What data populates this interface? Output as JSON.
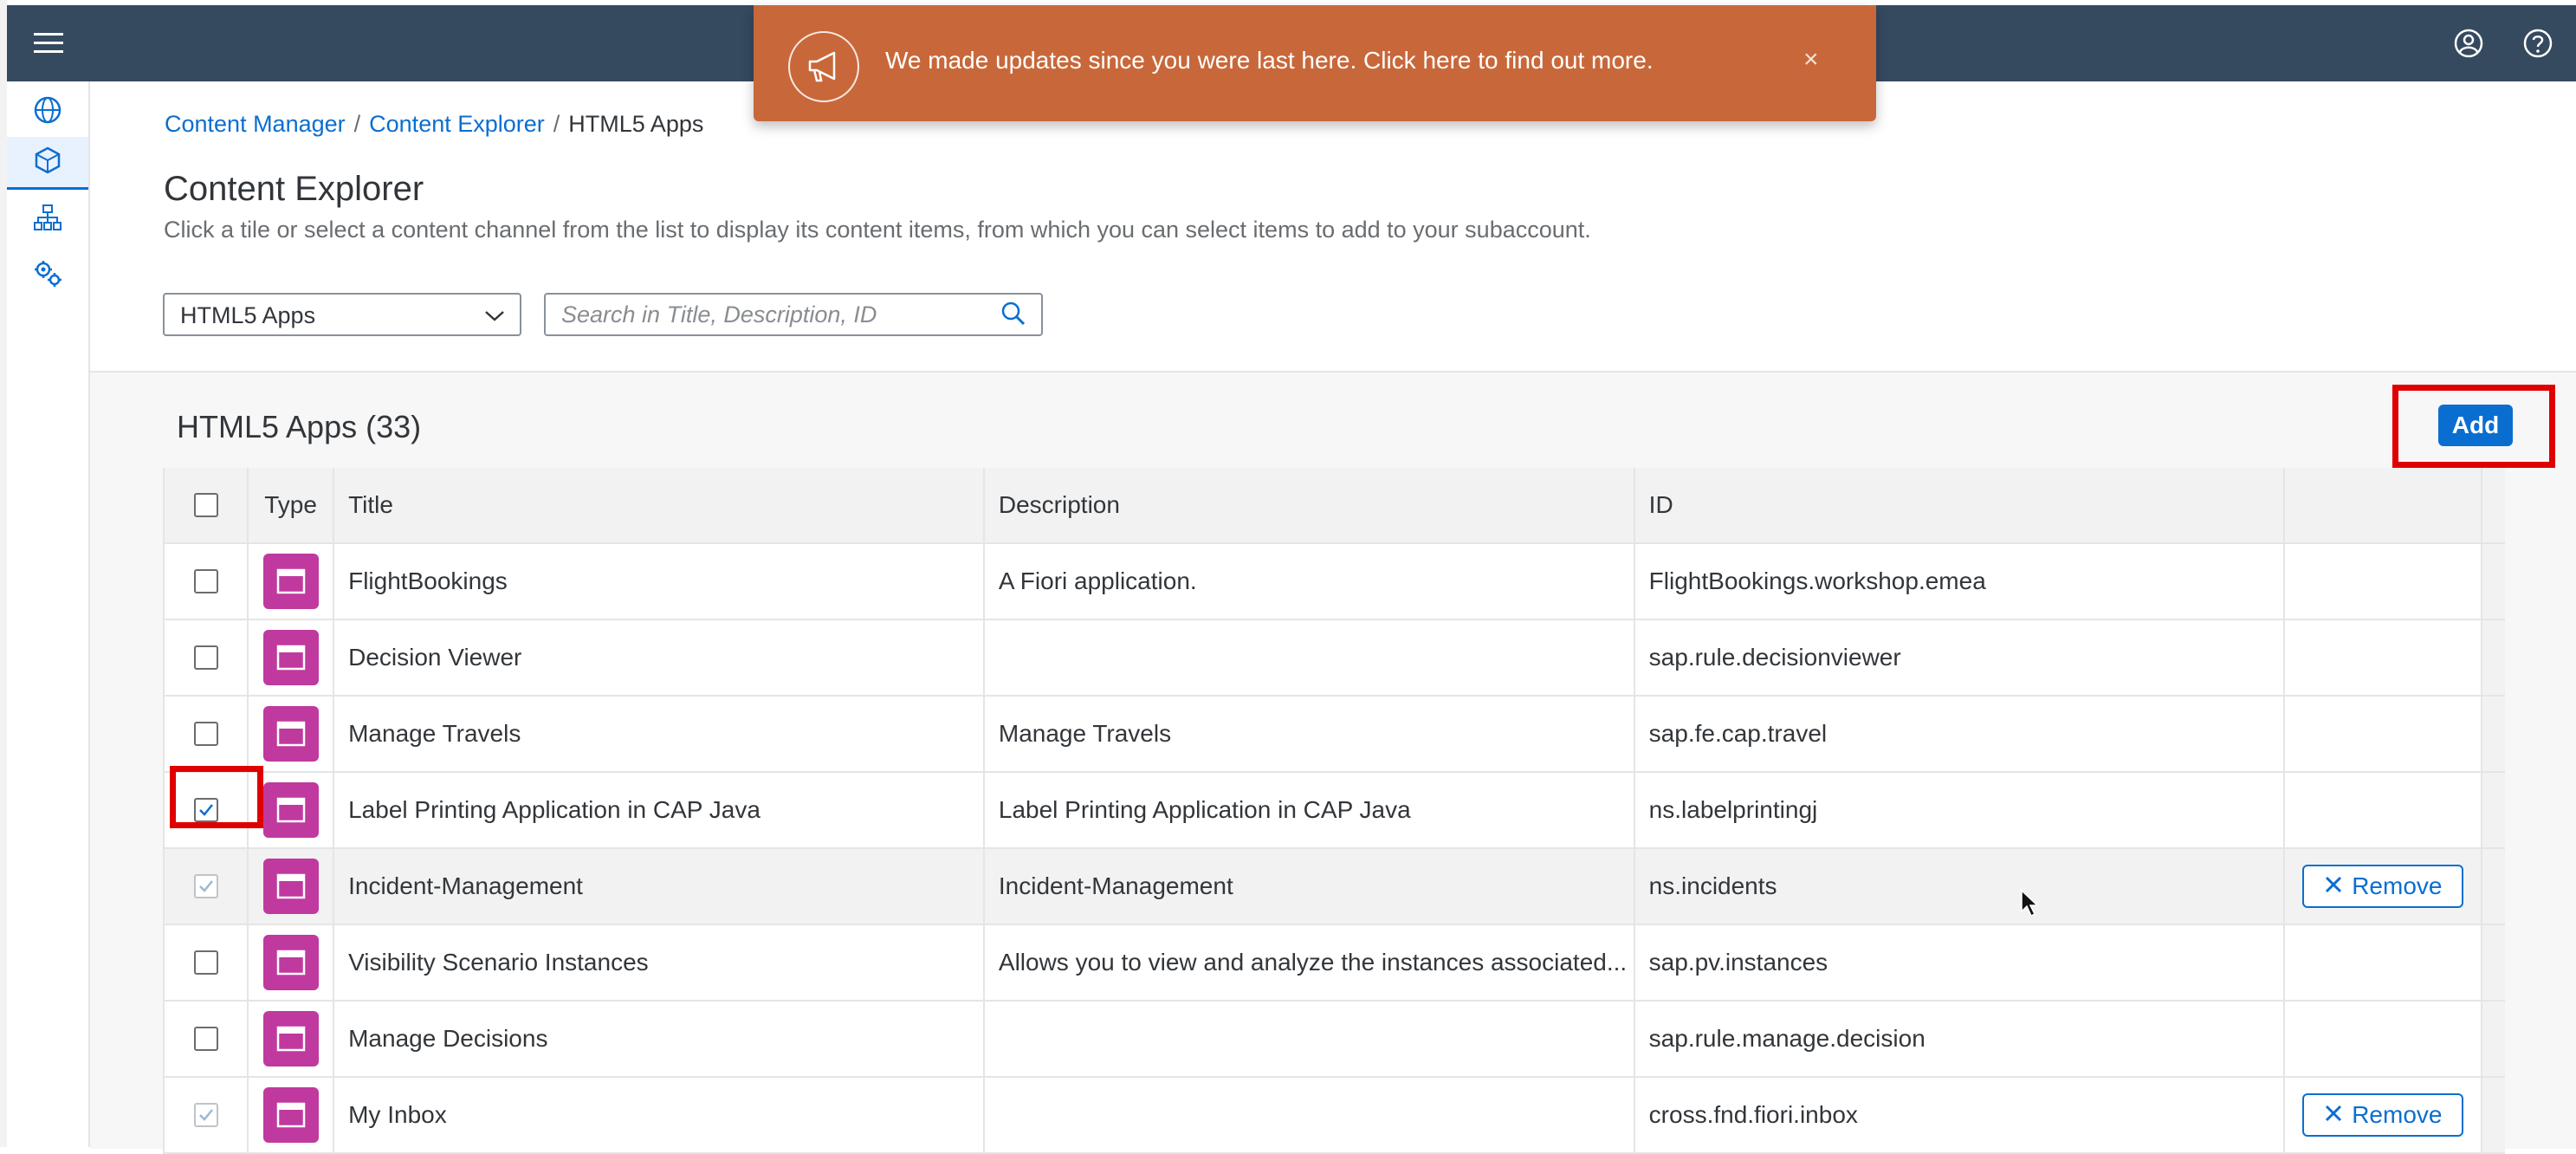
{
  "shell": {
    "menu_icon": "hamburger-menu-icon",
    "user_icon": "user-profile-icon",
    "help_icon": "help-icon"
  },
  "side_nav": [
    {
      "icon": "globe-icon",
      "active": false
    },
    {
      "icon": "content-cube-icon",
      "active": true
    },
    {
      "icon": "sitemap-icon",
      "active": false
    },
    {
      "icon": "settings-gear-icon",
      "active": false
    }
  ],
  "notification": {
    "message": "We made updates since you were last here. Click here to find out more.",
    "close_glyph": "×",
    "color": "#c8683a"
  },
  "breadcrumb": {
    "items": [
      "Content Manager",
      "Content Explorer"
    ],
    "separator": "/",
    "current": "HTML5 Apps"
  },
  "page": {
    "title": "Content Explorer",
    "description": "Click a tile or select a content channel from the list to display its content items, from which you can select items to add to your subaccount."
  },
  "filter": {
    "channel_value": "HTML5 Apps",
    "search_placeholder": "Search in Title, Description, ID"
  },
  "table": {
    "title": "HTML5 Apps (33)",
    "add_label": "Add",
    "columns": {
      "type": "Type",
      "title": "Title",
      "description": "Description",
      "id": "ID"
    },
    "remove_label": "Remove",
    "rows": [
      {
        "title": "FlightBookings",
        "description": "A Fiori application.",
        "id": "FlightBookings.workshop.emea",
        "state": "unchecked"
      },
      {
        "title": "Decision Viewer",
        "description": "",
        "id": "sap.rule.decisionviewer",
        "state": "unchecked"
      },
      {
        "title": "Manage Travels",
        "description": "Manage Travels",
        "id": "sap.fe.cap.travel",
        "state": "unchecked"
      },
      {
        "title": "Label Printing Application in CAP Java",
        "description": "Label Printing Application in CAP Java",
        "id": "ns.labelprintingj",
        "state": "checked"
      },
      {
        "title": "Incident-Management",
        "description": "Incident-Management",
        "id": "ns.incidents",
        "state": "added"
      },
      {
        "title": "Visibility Scenario Instances",
        "description": "Allows you to view and analyze the instances associated...",
        "id": "sap.pv.instances",
        "state": "unchecked"
      },
      {
        "title": "Manage Decisions",
        "description": "",
        "id": "sap.rule.manage.decision",
        "state": "unchecked"
      },
      {
        "title": "My Inbox",
        "description": "",
        "id": "cross.fnd.fiori.inbox",
        "state": "added"
      }
    ]
  },
  "colors": {
    "shell": "#354a5f",
    "accent": "#0a6ed1",
    "tile": "#c0399f",
    "highlight": "#e00000"
  }
}
